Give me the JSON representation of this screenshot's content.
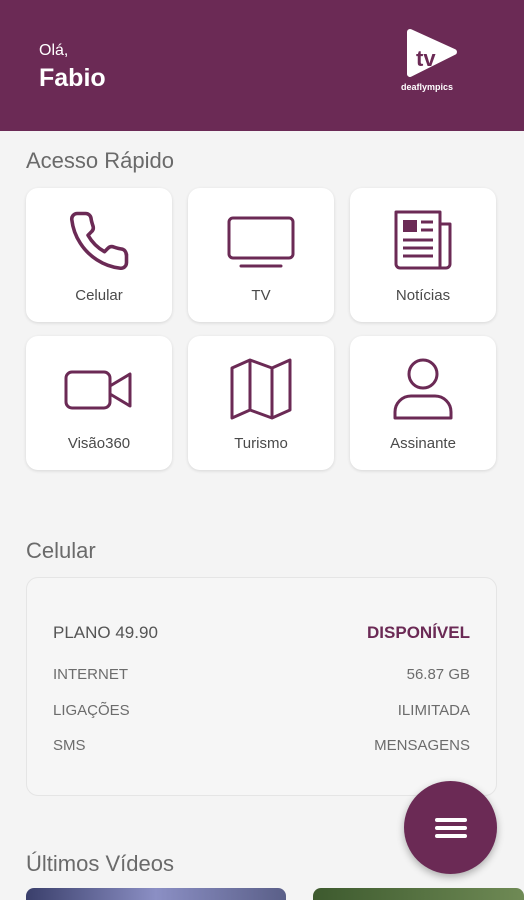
{
  "header": {
    "greeting": "Olá,",
    "user_name": "Fabio",
    "logo": {
      "text": "tv",
      "subtext": "deaflympics",
      "icon": "tv-logo-icon"
    }
  },
  "quick_access": {
    "title": "Acesso Rápido",
    "tiles": [
      {
        "label": "Celular",
        "icon": "phone-icon"
      },
      {
        "label": "TV",
        "icon": "tv-icon"
      },
      {
        "label": "Notícias",
        "icon": "newspaper-icon"
      },
      {
        "label": "Visão360",
        "icon": "video-camera-icon"
      },
      {
        "label": "Turismo",
        "icon": "map-icon"
      },
      {
        "label": "Assinante",
        "icon": "user-icon"
      }
    ]
  },
  "celular": {
    "title": "Celular",
    "plan": {
      "label": "PLANO 49.90",
      "status": "DISPONÍVEL"
    },
    "rows": [
      {
        "label": "INTERNET",
        "value": "56.87 GB"
      },
      {
        "label": "LIGAÇÕES",
        "value": "ILIMITADA"
      },
      {
        "label": "SMS",
        "value": "MENSAGENS"
      }
    ]
  },
  "videos": {
    "title": "Últimos Vídeos"
  },
  "colors": {
    "brand": "#6b2a55",
    "background": "#f4f4f4",
    "card": "#ffffff"
  }
}
